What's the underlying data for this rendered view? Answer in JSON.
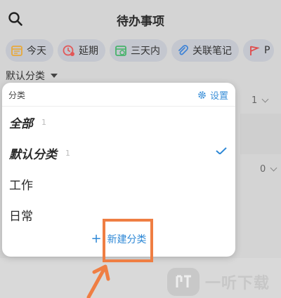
{
  "header": {
    "title": "待办事项"
  },
  "chips": [
    {
      "label": "今天",
      "icon": "calendar-today-icon",
      "color": "#e8a93a"
    },
    {
      "label": "延期",
      "icon": "clock-overdue-icon",
      "color": "#e25757"
    },
    {
      "label": "三天内",
      "icon": "calendar-three-days-icon",
      "color": "#47b36b"
    },
    {
      "label": "关联笔记",
      "icon": "paperclip-icon",
      "color": "#3d82d6"
    },
    {
      "label": "P",
      "icon": "flag-icon",
      "color": "#e04a4a"
    }
  ],
  "category_select": {
    "value": "默认分类"
  },
  "background": {
    "count_top": "1",
    "count_bottom": "0"
  },
  "panel": {
    "header_label": "分类",
    "settings_label": "设置",
    "items": [
      {
        "name": "全部",
        "count": "1"
      },
      {
        "name": "默认分类",
        "count": "1",
        "selected": true
      },
      {
        "name": "工作",
        "count": ""
      },
      {
        "name": "日常",
        "count": ""
      }
    ],
    "new_category_label": "新建分类"
  },
  "watermark": {
    "text": "一听下载"
  },
  "colors": {
    "accent": "#2e88d6",
    "highlight": "#ef7e43"
  }
}
